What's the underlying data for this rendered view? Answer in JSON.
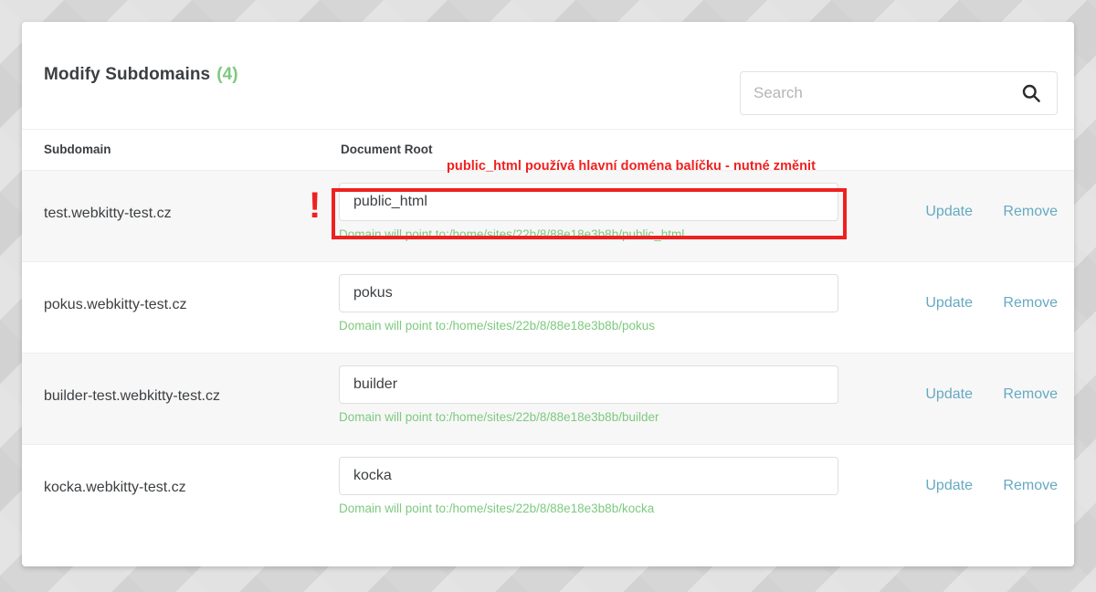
{
  "card": {
    "title": "Modify Subdomains",
    "count": "(4)"
  },
  "search": {
    "placeholder": "Search",
    "value": "",
    "icon": "search-icon"
  },
  "table": {
    "columns": {
      "subdomain": "Subdomain",
      "document_root": "Document Root"
    },
    "rows": [
      {
        "subdomain": "test.webkitty-test.cz",
        "document_root": "public_html",
        "hint": "Domain will point to:/home/sites/22b/8/88e18e3b8b/public_html",
        "update_label": "Update",
        "remove_label": "Remove",
        "highlighted": true
      },
      {
        "subdomain": "pokus.webkitty-test.cz",
        "document_root": "pokus",
        "hint": "Domain will point to:/home/sites/22b/8/88e18e3b8b/pokus",
        "update_label": "Update",
        "remove_label": "Remove",
        "highlighted": false
      },
      {
        "subdomain": "builder-test.webkitty-test.cz",
        "document_root": "builder",
        "hint": "Domain will point to:/home/sites/22b/8/88e18e3b8b/builder",
        "update_label": "Update",
        "remove_label": "Remove",
        "highlighted": false
      },
      {
        "subdomain": "kocka.webkitty-test.cz",
        "document_root": "kocka",
        "hint": "Domain will point to:/home/sites/22b/8/88e18e3b8b/kocka",
        "update_label": "Update",
        "remove_label": "Remove",
        "highlighted": false
      }
    ]
  },
  "annotation": {
    "note": "public_html používá hlavní doména balíčku - nutné změnit",
    "exclamation": "!"
  },
  "colors": {
    "accent_green": "#7dc97f",
    "link_blue": "#66a9c2",
    "annotation_red": "#f02020",
    "text_dark": "#3c3f42",
    "row_stripe": "#f7f7f7"
  }
}
